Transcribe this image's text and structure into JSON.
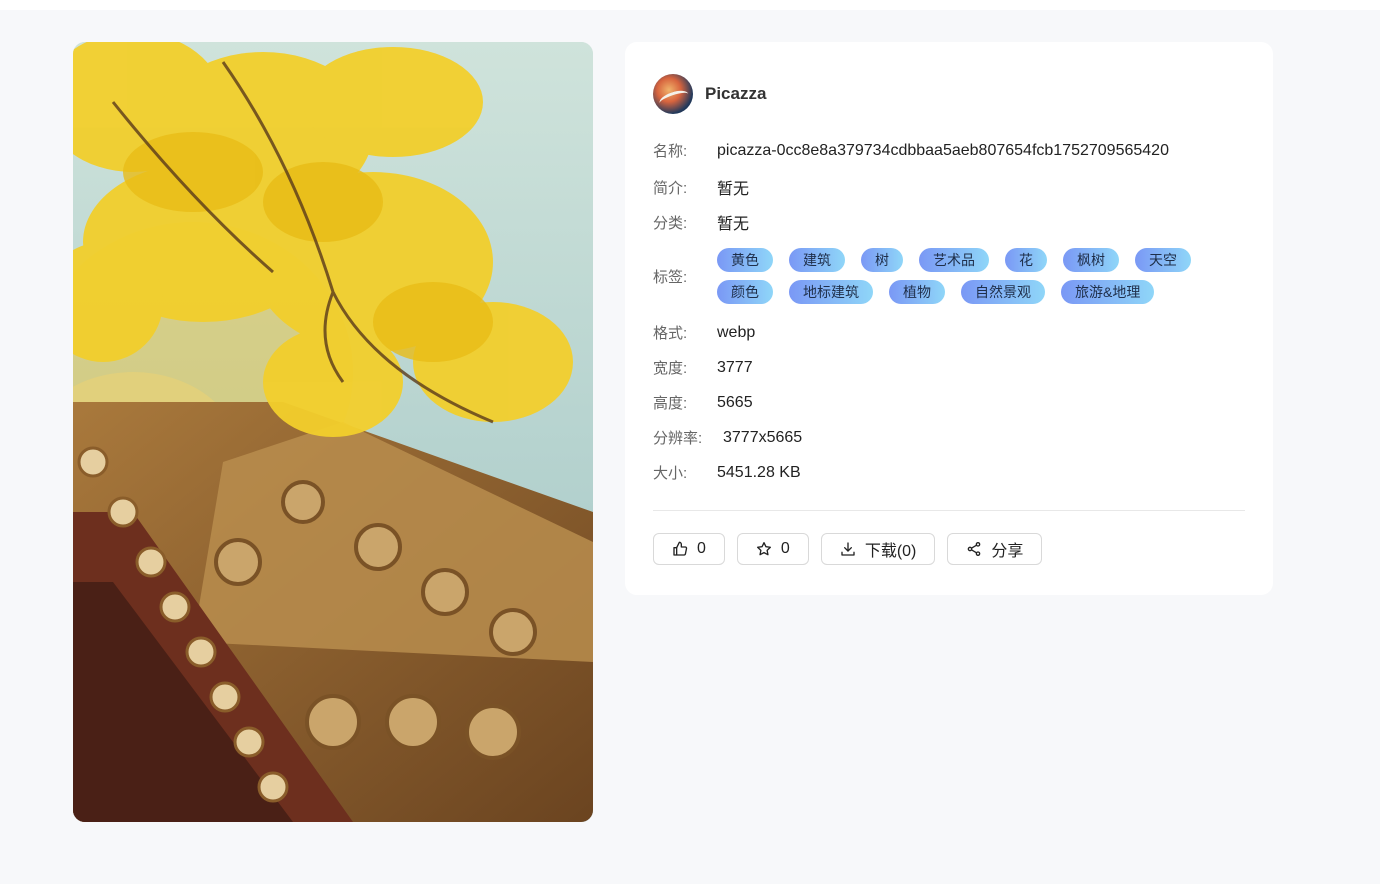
{
  "author": {
    "name": "Picazza"
  },
  "fields": {
    "name_label": "名称:",
    "name_value": "picazza-0cc8e8a379734cdbbaa5aeb807654fcb1752709565420",
    "intro_label": "简介:",
    "intro_value": "暂无",
    "category_label": "分类:",
    "category_value": "暂无",
    "tags_label": "标签:",
    "format_label": "格式:",
    "format_value": "webp",
    "width_label": "宽度:",
    "width_value": "3777",
    "height_label": "高度:",
    "height_value": "5665",
    "resolution_label": "分辨率:",
    "resolution_value": "3777x5665",
    "size_label": "大小:",
    "size_value": "5451.28 KB"
  },
  "tags": [
    "黄色",
    "建筑",
    "树",
    "艺术品",
    "花",
    "枫树",
    "天空",
    "颜色",
    "地标建筑",
    "植物",
    "自然景观",
    "旅游&地理"
  ],
  "actions": {
    "like_count": "0",
    "favorite_count": "0",
    "download_label": "下载(0)",
    "share_label": "分享"
  },
  "icons": {
    "like": "thumbs-up-icon",
    "favorite": "star-icon",
    "download": "download-icon",
    "share": "share-icon"
  },
  "colors": {
    "tag_gradient_start": "#7a98f5",
    "tag_gradient_end": "#8fd6f8",
    "page_background": "#f7f8fa"
  }
}
